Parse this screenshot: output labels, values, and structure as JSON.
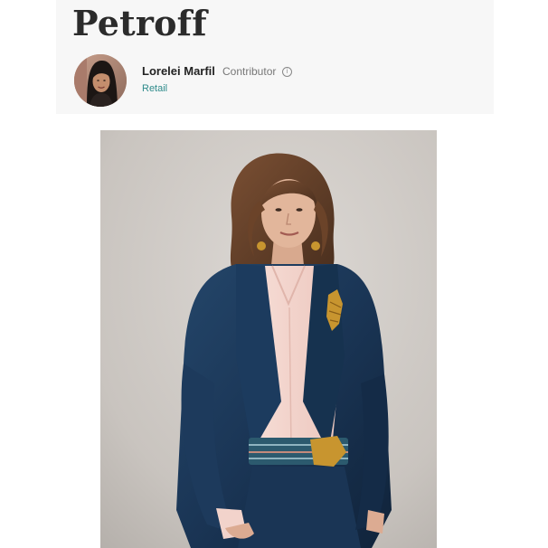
{
  "article": {
    "title": "Petroff"
  },
  "author": {
    "name": "Lorelei Marfil",
    "role": "Contributor",
    "section": "Retail"
  },
  "icons": {
    "info": "info-circle-icon"
  },
  "colors": {
    "header_background": "#f7f7f7",
    "section_link": "#2e8b8b",
    "photo_backdrop": "#cfcac6",
    "jacket_velvet": "#1f3a5a",
    "blouse_pink": "#f4d6cf"
  }
}
